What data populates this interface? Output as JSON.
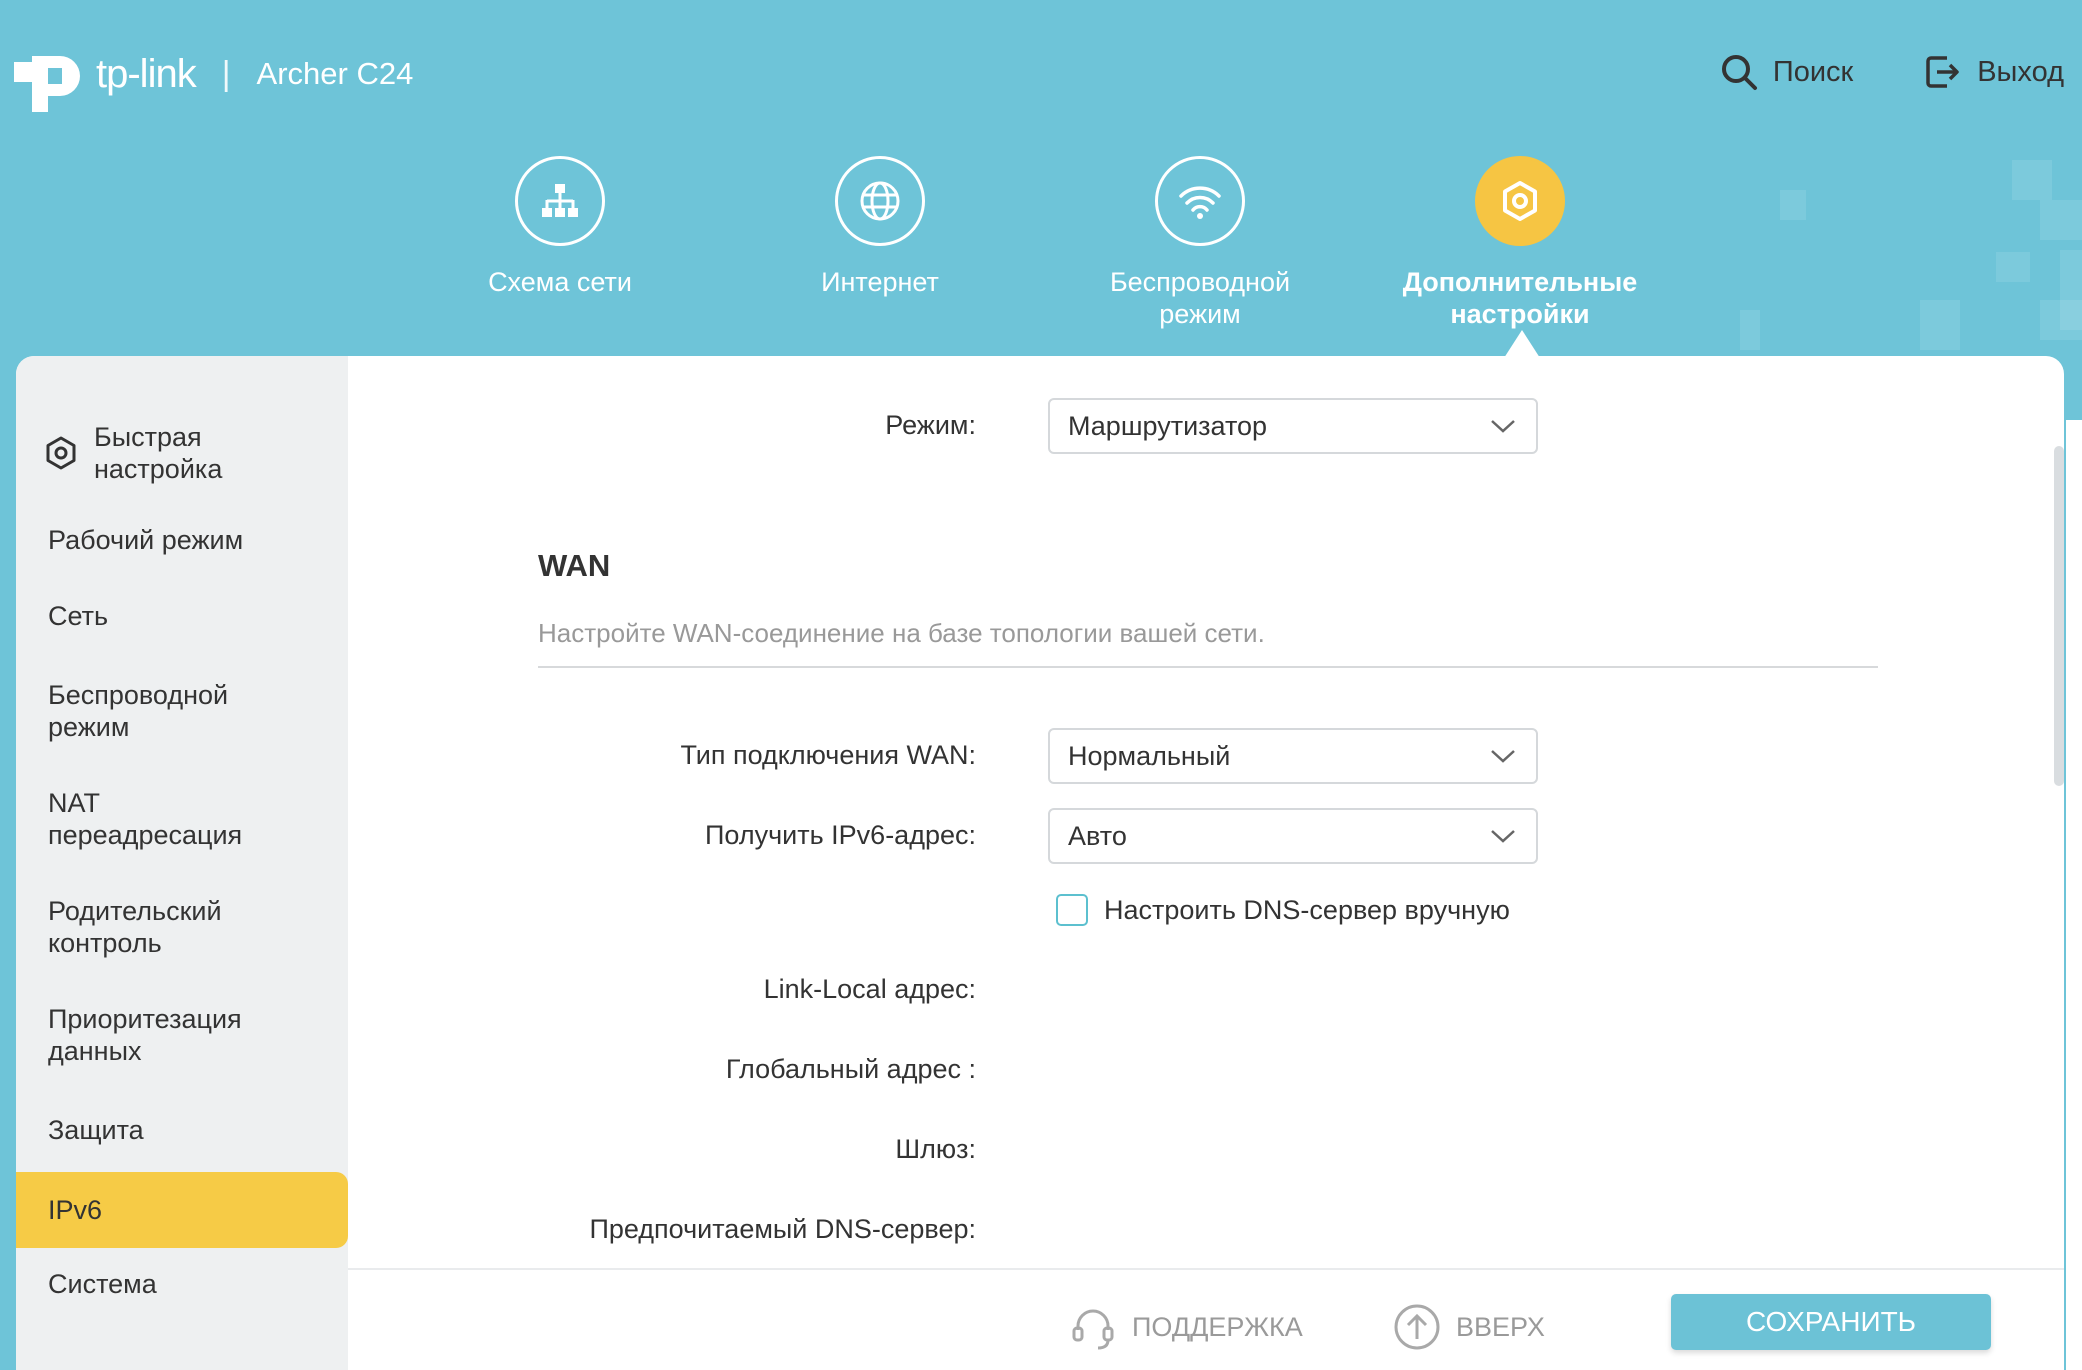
{
  "header": {
    "brand": "tp-link",
    "separator": "|",
    "model": "Archer C24",
    "search_label": "Поиск",
    "logout_label": "Выход"
  },
  "nav": {
    "items": [
      {
        "label": "Схема сети",
        "icon": "network-map-icon"
      },
      {
        "label": "Интернет",
        "icon": "globe-icon"
      },
      {
        "label": "Беспроводной режим",
        "icon": "wifi-icon"
      },
      {
        "label": "Дополнительные настройки",
        "icon": "gear-icon",
        "active": true
      }
    ]
  },
  "sidebar": {
    "items": [
      {
        "label": "Быстрая настройка",
        "icon": "gear-icon"
      },
      {
        "label": "Рабочий режим"
      },
      {
        "label": "Сеть"
      },
      {
        "label": "Беспроводной режим"
      },
      {
        "label": "NAT переадресация"
      },
      {
        "label": "Родительский контроль"
      },
      {
        "label": "Приоритезация данных"
      },
      {
        "label": "Защита"
      },
      {
        "label": "IPv6",
        "active": true
      },
      {
        "label": "Система"
      }
    ]
  },
  "form": {
    "mode_label": "Режим:",
    "mode_value": "Маршрутизатор",
    "section_title": "WAN",
    "section_desc": "Настройте WAN-соединение на базе топологии вашей сети.",
    "wan_type_label": "Тип подключения WAN:",
    "wan_type_value": "Нормальный",
    "ipv6_label": "Получить IPv6-адрес:",
    "ipv6_value": "Авто",
    "dns_manual_label": "Настроить DNS-сервер вручную",
    "link_local_label": "Link-Local адрес:",
    "global_label": "Глобальный адрес :",
    "gateway_label": "Шлюз:",
    "dns_label": "Предпочитаемый DNS-сервер:"
  },
  "footer": {
    "support_label": "ПОДДЕРЖКА",
    "top_label": "ВВЕРХ",
    "save_label": "СОХРАНИТЬ"
  },
  "colors": {
    "header_bg": "#6ec4d8",
    "accent_yellow": "#f6c543",
    "save_button": "#6cc2d6"
  }
}
